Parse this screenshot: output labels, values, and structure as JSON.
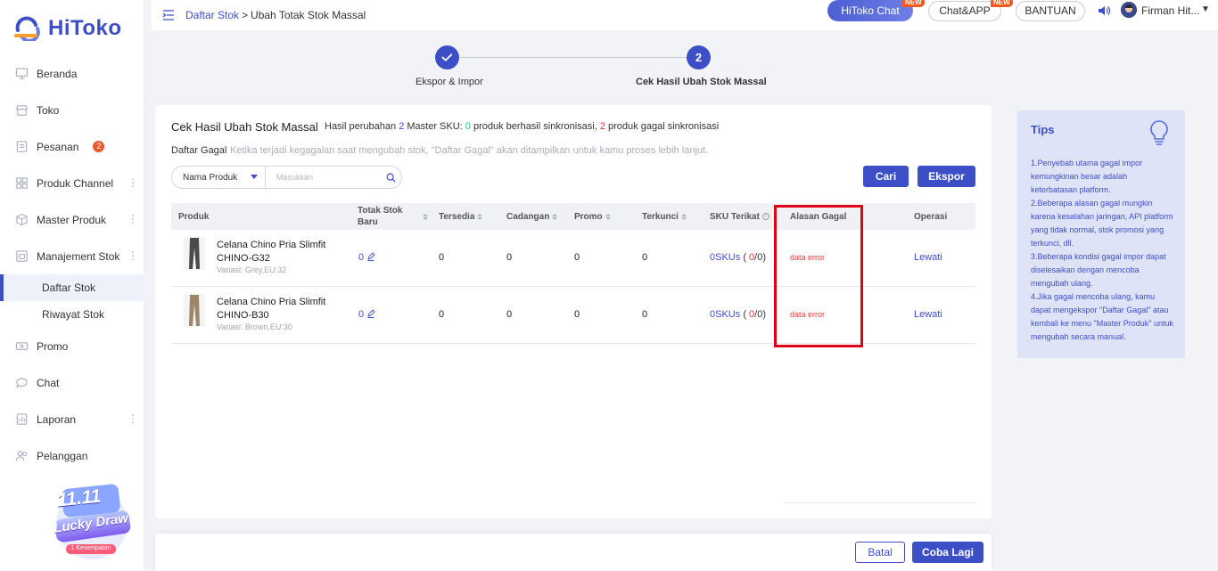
{
  "brand": {
    "name": "HiToko",
    "accent": "#3d4fc7"
  },
  "sidebar": {
    "items": [
      {
        "label": "Beranda",
        "icon": "monitor-icon"
      },
      {
        "label": "Toko",
        "icon": "store-icon"
      },
      {
        "label": "Pesanan",
        "icon": "order-icon",
        "badge": "2"
      },
      {
        "label": "Produk Channel",
        "icon": "grid-icon"
      },
      {
        "label": "Master Produk",
        "icon": "box-icon"
      },
      {
        "label": "Manajement Stok",
        "icon": "warehouse-icon"
      },
      {
        "label": "Promo",
        "icon": "ticket-icon"
      },
      {
        "label": "Chat",
        "icon": "chat-bubble-icon"
      },
      {
        "label": "Laporan",
        "icon": "report-icon"
      },
      {
        "label": "Pelanggan",
        "icon": "users-icon"
      }
    ],
    "sub_items": [
      {
        "label": "Daftar Stok",
        "active": true
      },
      {
        "label": "Riwayat Stok",
        "active": false
      }
    ],
    "promo_banner": {
      "title_top": "11.11",
      "title_bottom": "Lucky Draw",
      "chance": "1 Kesempatan"
    }
  },
  "topbar": {
    "breadcrumb_link": "Daftar Stok",
    "breadcrumb_sep": ">",
    "breadcrumb_current": "Ubah Totak Stok Massal",
    "hitoko_chat": "HiToko Chat",
    "chat_app": "Chat&APP",
    "new_tag": "NEW",
    "help": "BANTUAN",
    "user_name": "Firman Hit...",
    "caret": "▼"
  },
  "stepper": {
    "step1_label": "Ekspor & Impor",
    "step2_number": "2",
    "step2_label": "Cek Hasil Ubah Stok Massal"
  },
  "card": {
    "title": "Cek Hasil Ubah Stok Massal",
    "summary_prefix": "Hasil perubahan",
    "summary_total": "2",
    "summary_mid": "Master SKU:",
    "summary_success": "0",
    "summary_success_text": "produk berhasil sinkronisasi,",
    "summary_failed": "2",
    "summary_failed_text": "produk gagal sinkronisasi",
    "fail_list_label": "Daftar Gagal",
    "fail_list_desc": "Ketika terjadi kegagalan saat mengubah stok, \"Daftar Gagal\" akan ditampilkan untuk kamu proses lebih lanjut.",
    "search_select": "Nama Produk",
    "search_placeholder": "Masukkan",
    "search_button": "Cari",
    "export_button": "Ekspor"
  },
  "table": {
    "headers": {
      "produk": "Produk",
      "totak_stok_baru_1": "Totak Stok",
      "totak_stok_baru_2": "Baru",
      "tersedia": "Tersedia",
      "cadangan": "Cadangan",
      "promo": "Promo",
      "terkunci": "Terkunci",
      "sku_terikat": "SKU Terikat",
      "alasan_gagal": "Alasan Gagal",
      "operasi": "Operasi"
    },
    "rows": [
      {
        "name": "Celana Chino Pria Slimfit CHINO-G32",
        "variant": "Variasi: Grey,EU:32",
        "new_stock": "0",
        "tersedia": "0",
        "cadangan": "0",
        "promo": "0",
        "terkunci": "0",
        "sku_count": "0SKUs",
        "sku_open": "(",
        "sku_fail": "0",
        "sku_close": "/0)",
        "reason": "data error",
        "action": "Lewati",
        "image_color": "#4a4a4a"
      },
      {
        "name": "Celana Chino Pria Slimfit CHINO-B30",
        "variant": "Variasi: Brown,EU:30",
        "new_stock": "0",
        "tersedia": "0",
        "cadangan": "0",
        "promo": "0",
        "terkunci": "0",
        "sku_count": "0SKUs",
        "sku_open": "(",
        "sku_fail": "0",
        "sku_close": "/0)",
        "reason": "data error",
        "action": "Lewati",
        "image_color": "#9c8767"
      }
    ]
  },
  "tips": {
    "title": "Tips",
    "lines": [
      "1.Penyebab utama gagal impor kemungkinan besar adalah keterbatasan platform.",
      "2.Beberapa alasan gagal mungkin karena kesalahan jaringan, API platform yang tidak normal, stok promosi yang terkunci, dll.",
      "3.Beberapa kondisi gagal impor dapat diselesaikan dengan mencoba mengubah ulang.",
      "4.Jika gagal mencoba ulang, kamu dapat mengekspor \"Daftar Gagal\" atau kembali ke menu \"Master Produk\" untuk mengubah secara manual."
    ]
  },
  "footer": {
    "cancel": "Batal",
    "retry": "Coba Lagi"
  }
}
